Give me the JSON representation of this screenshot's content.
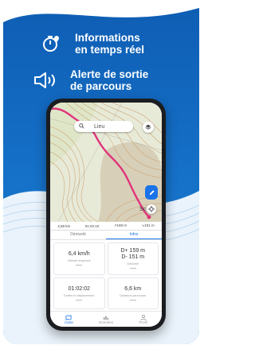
{
  "features": [
    {
      "icon": "timer-location-icon",
      "line1": "Informations",
      "line2": "en temps réel"
    },
    {
      "icon": "speaker-icon",
      "line1": "Alerte de sortie",
      "line2": "de parcours"
    }
  ],
  "map": {
    "search_placeholder": "Lieu",
    "place_label": "Sc",
    "stats": [
      "4,58 km",
      "01:02:10",
      "↗159 m",
      "↘151 m"
    ]
  },
  "tabs": [
    "Dénivelé",
    "Infos"
  ],
  "info_cells": [
    {
      "value": "6,4 km/h",
      "label": "Vitesse moyenne"
    },
    {
      "value": "D+ 159 m\nD- 151 m",
      "label": "Dénivelé"
    },
    {
      "value": "01:02:02",
      "label": "Durée en déplacement"
    },
    {
      "value": "6,6 km",
      "label": "Distance parcourue"
    }
  ],
  "bottom_nav": [
    "Carte",
    "Données",
    "Profil"
  ],
  "colors": {
    "brand_blue": "#1672c9",
    "track_pink": "#e0337a",
    "accent": "#1a73e8"
  }
}
